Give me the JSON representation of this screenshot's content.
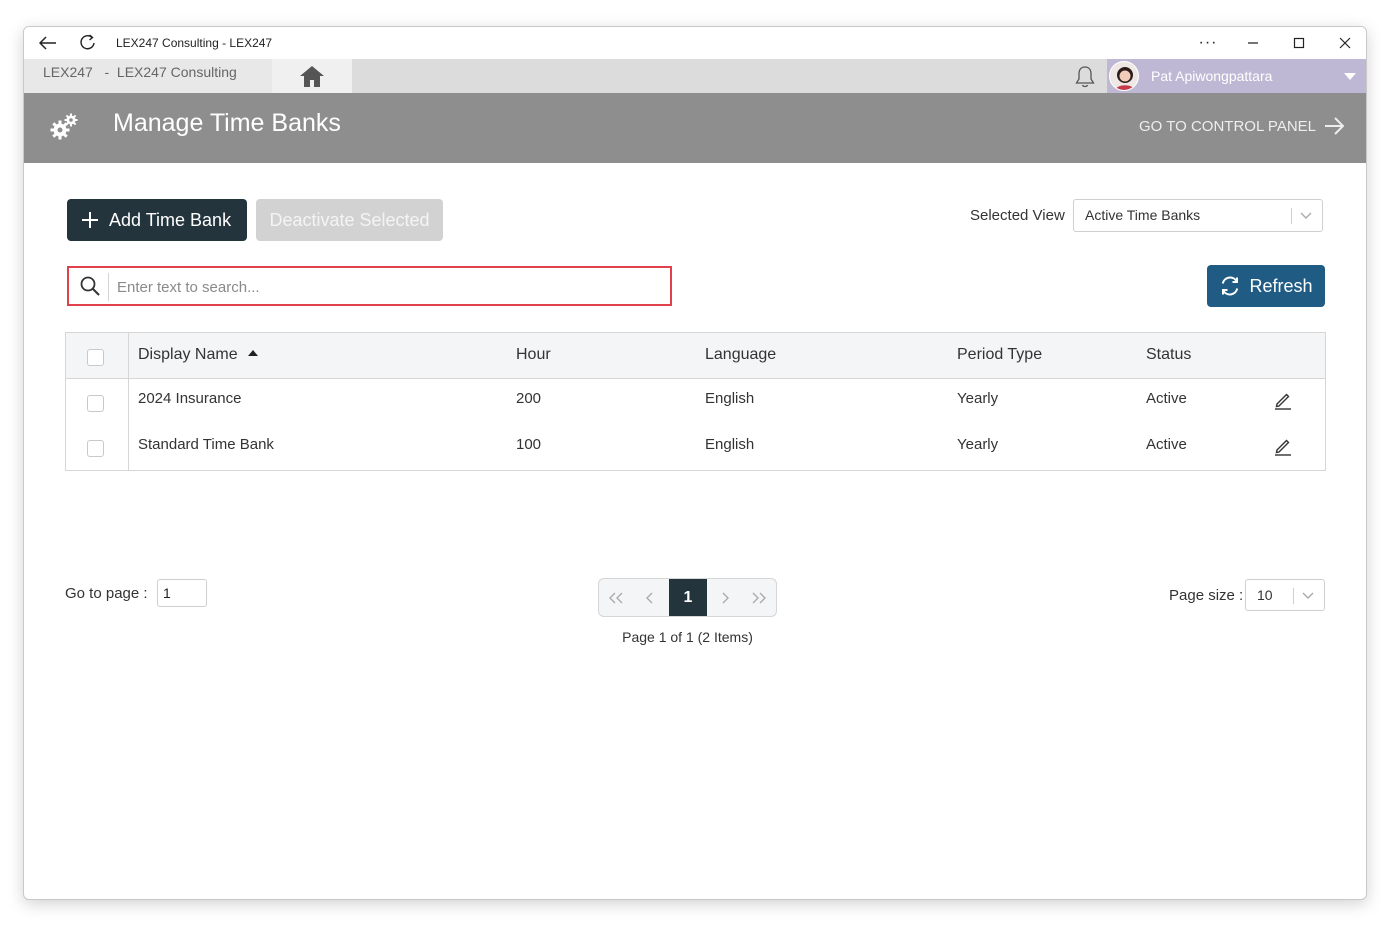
{
  "window": {
    "title": "LEX247 Consulting - LEX247",
    "back_icon": "arrow-left-icon",
    "reload_icon": "refresh-icon",
    "more_icon": "ellipsis-icon",
    "controls": [
      "minimize",
      "maximize",
      "close"
    ]
  },
  "tabbar": {
    "breadcrumb": "LEX247   -  LEX247 Consulting",
    "home_icon": "home-icon",
    "bell_icon": "bell-icon",
    "user_name": "Pat Apiwongpattara",
    "user_bg": "#bfb8d4"
  },
  "header": {
    "title": "Manage Time Banks",
    "control_panel_link": "GO TO CONTROL PANEL",
    "bg": "#8e8e8e"
  },
  "toolbar": {
    "add_label": "Add Time Bank",
    "deactivate_label": "Deactivate Selected",
    "selected_view_label": "Selected View",
    "selected_view_value": "Active Time Banks",
    "refresh_label": "Refresh",
    "primary_color": "#23343d",
    "refresh_color": "#1f5b83"
  },
  "search": {
    "placeholder": "Enter text to search...",
    "value": ""
  },
  "table": {
    "columns": [
      "Display Name",
      "Hour",
      "Language",
      "Period Type",
      "Status"
    ],
    "sorted_column": "Display Name",
    "sort_direction": "ascending",
    "rows": [
      {
        "name": "2024 Insurance",
        "hour": "200",
        "language": "English",
        "period": "Yearly",
        "status": "Active"
      },
      {
        "name": "Standard Time Bank",
        "hour": "100",
        "language": "English",
        "period": "Yearly",
        "status": "Active"
      }
    ]
  },
  "pagination": {
    "goto_label": "Go to page :",
    "goto_value": "1",
    "current_page": "1",
    "info": "Page 1 of 1 (2 Items)",
    "page_size_label": "Page size :",
    "page_size": "10"
  }
}
